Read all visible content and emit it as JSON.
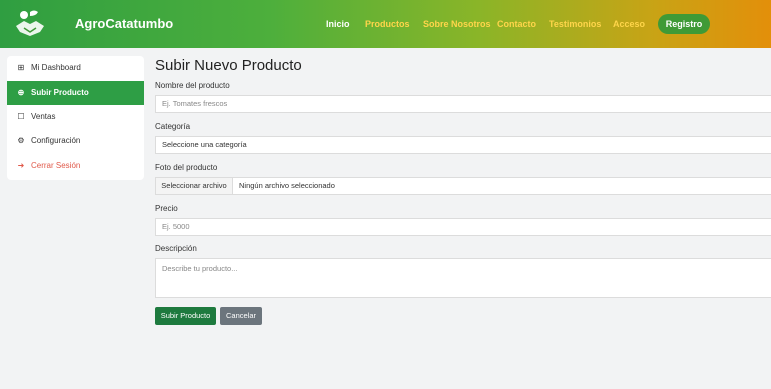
{
  "navbar": {
    "brand": "AgroCatatumbo",
    "links": [
      "Inicio",
      "Productos",
      "Sobre Nosotros",
      "Contacto",
      "Testimonios",
      "Acceso"
    ],
    "register_label": "Registro"
  },
  "sidebar": {
    "items": [
      {
        "label": "Mi Dashboard",
        "icon": "dashboard-icon"
      },
      {
        "label": "Subir Producto",
        "icon": "plus-circle-icon"
      },
      {
        "label": "Ventas",
        "icon": "shopping-bag-icon"
      },
      {
        "label": "Configuración",
        "icon": "gear-icon"
      },
      {
        "label": "Cerrar Sesión",
        "icon": "logout-icon"
      }
    ]
  },
  "form": {
    "title": "Subir Nuevo Producto",
    "name_label": "Nombre del producto",
    "name_placeholder": "Ej. Tomates frescos",
    "category_label": "Categoría",
    "category_value": "Seleccione una categoría",
    "photo_label": "Foto del producto",
    "file_button": "Seleccionar archivo",
    "file_status": "Ningún archivo seleccionado",
    "price_label": "Precio",
    "price_placeholder": "Ej. 5000",
    "description_label": "Descripción",
    "description_placeholder": "Describe tu producto...",
    "submit_label": "Subir Producto",
    "cancel_label": "Cancelar"
  },
  "colors": {
    "primary_green": "#2e9e45",
    "submit_green": "#1e7a3e",
    "nav_link_yellow": "#ffd54a",
    "logout_red": "#e0594a",
    "cancel_gray": "#6c757d"
  }
}
